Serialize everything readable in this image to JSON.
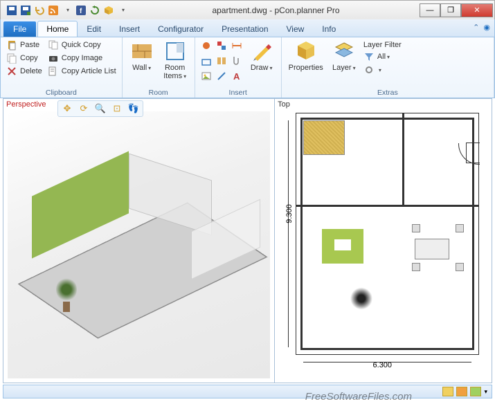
{
  "window": {
    "title": "apartment.dwg - pCon.planner Pro",
    "min": "—",
    "max": "❐",
    "close": "✕"
  },
  "qat_icons": [
    "save-icon",
    "save-as-icon",
    "undo-icon",
    "rss-icon",
    "rss-drop-icon",
    "facebook-icon",
    "refresh-icon",
    "cube-icon"
  ],
  "tabs": {
    "file": "File",
    "items": [
      "Home",
      "Edit",
      "Insert",
      "Configurator",
      "Presentation",
      "View",
      "Info"
    ],
    "active": "Home"
  },
  "ribbon": {
    "clipboard": {
      "label": "Clipboard",
      "paste": "Paste",
      "copy": "Copy",
      "delete": "Delete",
      "quick_copy": "Quick Copy",
      "copy_image": "Copy Image",
      "copy_article": "Copy Article List"
    },
    "room": {
      "label": "Room",
      "wall": "Wall",
      "room_items": "Room\nItems"
    },
    "insert": {
      "label": "Insert",
      "draw": "Draw"
    },
    "extras": {
      "label": "Extras",
      "properties": "Properties",
      "layer": "Layer",
      "layer_filter": "Layer Filter",
      "all": "All"
    }
  },
  "viewports": {
    "left": "Perspective",
    "right": "Top",
    "dim_v": "9.300",
    "dim_h": "6.300"
  },
  "watermark": "FreeSoftwareFiles.com"
}
